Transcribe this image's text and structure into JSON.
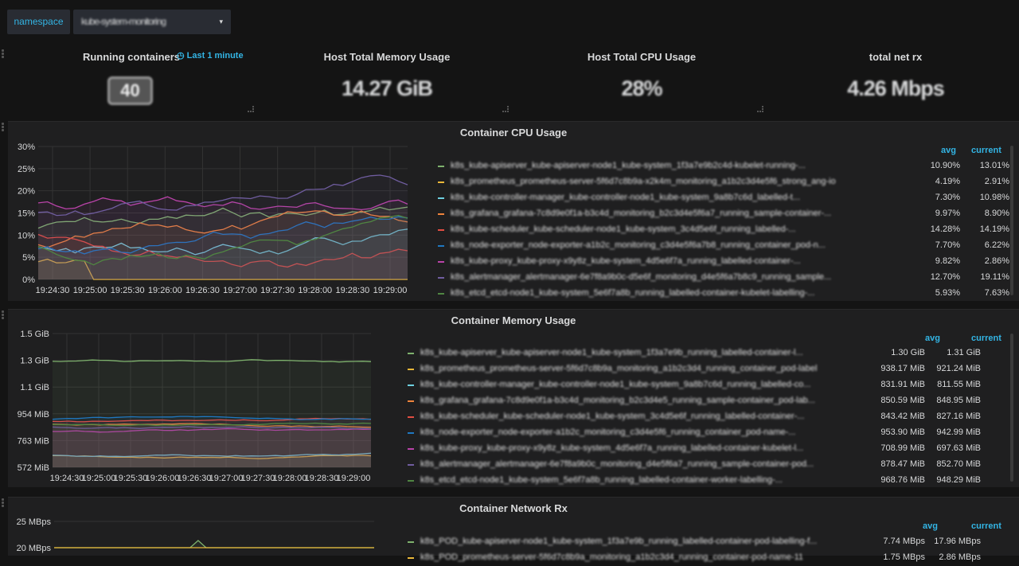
{
  "toolbar": {
    "namespace_label": "namespace",
    "namespace_value": "kube-system-monitoring",
    "caret": "▾"
  },
  "stats": [
    {
      "title": "Running containers",
      "value": "40",
      "time_info": "Last 1 minute"
    },
    {
      "title": "Host Total Memory Usage",
      "value": "14.27 GiB"
    },
    {
      "title": "Host Total CPU Usage",
      "value": "28%"
    },
    {
      "title": "total net rx",
      "value": "4.26 Mbps"
    }
  ],
  "cpu_panel": {
    "title": "Container CPU Usage",
    "y_ticks": [
      "30%",
      "25%",
      "20%",
      "15%",
      "10%",
      "5%",
      "0%"
    ],
    "x_ticks": [
      "19:24:30",
      "19:25:00",
      "19:25:30",
      "19:26:00",
      "19:26:30",
      "19:27:00",
      "19:27:30",
      "19:28:00",
      "19:28:30",
      "19:29:00"
    ],
    "legend_avg": "avg",
    "legend_current": "current",
    "legend": [
      {
        "name": "k8s_kube-apiserver_kube-apiserver-node1_kube-system_1f3a7e9b2c4d-kubelet-running-...",
        "color": "#7eb26d",
        "avg": "10.90%",
        "current": "13.01%"
      },
      {
        "name": "k8s_prometheus_prometheus-server-5f6d7c8b9a-x2k4m_monitoring_a1b2c3d4e5f6_strong_ang-io",
        "color": "#eab839",
        "avg": "4.19%",
        "current": "2.91%"
      },
      {
        "name": "k8s_kube-controller-manager_kube-controller-node1_kube-system_9a8b7c6d_labelled-t...",
        "color": "#6ed0e0",
        "avg": "7.30%",
        "current": "10.98%"
      },
      {
        "name": "k8s_grafana_grafana-7c8d9e0f1a-b3c4d_monitoring_b2c3d4e5f6a7_running_sample-container-...",
        "color": "#ef843c",
        "avg": "9.97%",
        "current": "8.90%"
      },
      {
        "name": "k8s_kube-scheduler_kube-scheduler-node1_kube-system_3c4d5e6f_running_labelled-...",
        "color": "#e24d42",
        "avg": "14.28%",
        "current": "14.19%"
      },
      {
        "name": "k8s_node-exporter_node-exporter-a1b2c_monitoring_c3d4e5f6a7b8_running_container_pod-n...",
        "color": "#1f78c1",
        "avg": "7.70%",
        "current": "6.22%"
      },
      {
        "name": "k8s_kube-proxy_kube-proxy-x9y8z_kube-system_4d5e6f7a_running_labelled-container-...",
        "color": "#ba43a9",
        "avg": "9.82%",
        "current": "2.86%"
      },
      {
        "name": "k8s_alertmanager_alertmanager-6e7f8a9b0c-d5e6f_monitoring_d4e5f6a7b8c9_running_sample...",
        "color": "#705da0",
        "avg": "12.70%",
        "current": "19.11%"
      },
      {
        "name": "k8s_etcd_etcd-node1_kube-system_5e6f7a8b_running_labelled-container-kubelet-labelling-...",
        "color": "#508642",
        "avg": "5.93%",
        "current": "7.63%"
      }
    ]
  },
  "mem_panel": {
    "title": "Container Memory Usage",
    "y_ticks": [
      "1.5 GiB",
      "1.3 GiB",
      "1.1 GiB",
      "954 MiB",
      "763 MiB",
      "572 MiB"
    ],
    "x_ticks": [
      "19:24:30",
      "19:25:00",
      "19:25:30",
      "19:26:00",
      "19:26:30",
      "19:27:00",
      "19:27:30",
      "19:28:00",
      "19:28:30",
      "19:29:00"
    ],
    "legend_avg": "avg",
    "legend_current": "current",
    "legend": [
      {
        "name": "k8s_kube-apiserver_kube-apiserver-node1_kube-system_1f3a7e9b_running_labelled-container-l...",
        "color": "#7eb26d",
        "avg": "1.30 GiB",
        "current": "1.31 GiB"
      },
      {
        "name": "k8s_prometheus_prometheus-server-5f6d7c8b9a_monitoring_a1b2c3d4_running_container_pod-label",
        "color": "#eab839",
        "avg": "938.17 MiB",
        "current": "921.24 MiB"
      },
      {
        "name": "k8s_kube-controller-manager_kube-controller-node1_kube-system_9a8b7c6d_running_labelled-co...",
        "color": "#6ed0e0",
        "avg": "831.91 MiB",
        "current": "811.55 MiB"
      },
      {
        "name": "k8s_grafana_grafana-7c8d9e0f1a-b3c4d_monitoring_b2c3d4e5_running_sample-container_pod-lab...",
        "color": "#ef843c",
        "avg": "850.59 MiB",
        "current": "848.95 MiB"
      },
      {
        "name": "k8s_kube-scheduler_kube-scheduler-node1_kube-system_3c4d5e6f_running_labelled-container-...",
        "color": "#e24d42",
        "avg": "843.42 MiB",
        "current": "827.16 MiB"
      },
      {
        "name": "k8s_node-exporter_node-exporter-a1b2c_monitoring_c3d4e5f6_running_container_pod-name-...",
        "color": "#1f78c1",
        "avg": "953.90 MiB",
        "current": "942.99 MiB"
      },
      {
        "name": "k8s_kube-proxy_kube-proxy-x9y8z_kube-system_4d5e6f7a_running_labelled-container-kubelet-l...",
        "color": "#ba43a9",
        "avg": "708.99 MiB",
        "current": "697.63 MiB"
      },
      {
        "name": "k8s_alertmanager_alertmanager-6e7f8a9b0c_monitoring_d4e5f6a7_running_sample-container-pod...",
        "color": "#705da0",
        "avg": "878.47 MiB",
        "current": "852.70 MiB"
      },
      {
        "name": "k8s_etcd_etcd-node1_kube-system_5e6f7a8b_running_labelled-container-worker-labelling-...",
        "color": "#508642",
        "avg": "968.76 MiB",
        "current": "948.29 MiB"
      }
    ]
  },
  "net_panel": {
    "title": "Container Network Rx",
    "y_ticks": [
      "25 MBps",
      "20 MBps"
    ],
    "legend_avg": "avg",
    "legend_current": "current",
    "legend": [
      {
        "name": "k8s_POD_kube-apiserver-node1_kube-system_1f3a7e9b_running_labelled-container-pod-labelling-f...",
        "color": "#7eb26d",
        "avg": "7.74 MBps",
        "current": "17.96 MBps"
      },
      {
        "name": "k8s_POD_prometheus-server-5f6d7c8b9a_monitoring_a1b2c3d4_running_container-pod-name-11",
        "color": "#eab839",
        "avg": "1.75 MBps",
        "current": "2.86 MBps"
      }
    ]
  }
}
